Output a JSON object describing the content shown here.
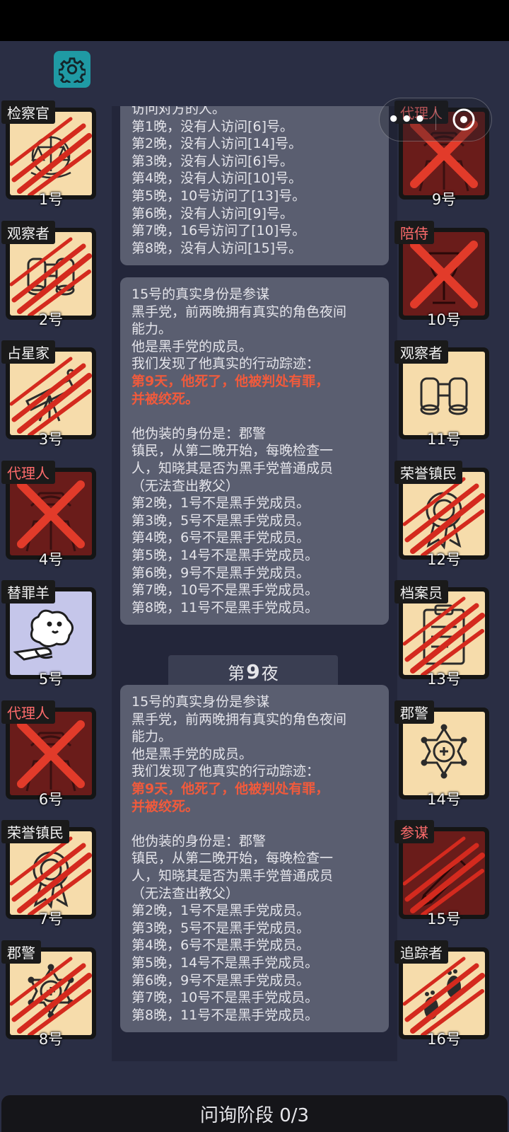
{
  "capsule": {
    "more_icon": "more-dots-icon",
    "close_icon": "target-close-icon"
  },
  "settings_icon": "gear-icon",
  "players_left": [
    {
      "role": "检察官",
      "num": "1号",
      "status": "slashed",
      "art": "scales",
      "role_red": false
    },
    {
      "role": "观察者",
      "num": "2号",
      "status": "slashed",
      "art": "binoculars",
      "role_red": false
    },
    {
      "role": "占星家",
      "num": "3号",
      "status": "slashed",
      "art": "telescope",
      "role_red": false
    },
    {
      "role": "代理人",
      "num": "4号",
      "status": "crossed",
      "art": "agent",
      "role_red": true
    },
    {
      "role": "替罪羊",
      "num": "5号",
      "status": "alive",
      "art": "sheep",
      "role_red": false
    },
    {
      "role": "代理人",
      "num": "6号",
      "status": "crossed",
      "art": "agent",
      "role_red": true
    },
    {
      "role": "荣誉镇民",
      "num": "7号",
      "status": "slashed",
      "art": "medal",
      "role_red": false
    },
    {
      "role": "郡警",
      "num": "8号",
      "status": "slashed",
      "art": "badge",
      "role_red": false
    }
  ],
  "players_right": [
    {
      "role": "代理人",
      "num": "9号",
      "status": "crossed",
      "art": "agent",
      "role_red": true
    },
    {
      "role": "陪侍",
      "num": "10号",
      "status": "crossed",
      "art": "glass",
      "role_red": true
    },
    {
      "role": "观察者",
      "num": "11号",
      "status": "alive",
      "art": "binoculars",
      "role_red": false
    },
    {
      "role": "荣誉镇民",
      "num": "12号",
      "status": "slashed",
      "art": "medal",
      "role_red": false
    },
    {
      "role": "档案员",
      "num": "13号",
      "status": "slashed",
      "art": "clipboard",
      "role_red": false
    },
    {
      "role": "郡警",
      "num": "14号",
      "status": "alive",
      "art": "badge",
      "role_red": false
    },
    {
      "role": "参谋",
      "num": "15号",
      "status": "slashed_dead",
      "art": "pen",
      "role_red": true
    },
    {
      "role": "追踪者",
      "num": "16号",
      "status": "slashed",
      "art": "footprints",
      "role_red": false
    }
  ],
  "messages": {
    "first": [
      "访问对方的人。",
      "第1晚，没有人访问[6]号。",
      "第2晚，没有人访问[14]号。",
      "第3晚，没有人访问[6]号。",
      "第4晚，没有人访问[10]号。",
      "第5晚，10号访问了[13]号。",
      "第6晚，没有人访问[9]号。",
      "第7晚，16号访问了[10]号。",
      "第8晚，没有人访问[15]号。"
    ],
    "second": {
      "identity": [
        "15号的真实身份是参谋",
        "黑手党，前两晚拥有真实的角色夜间",
        "能力。",
        "他是黑手党的成员。",
        "我们发现了他真实的行动踪迹："
      ],
      "death": [
        "第9天，他死了，他被判处有罪，",
        "并被绞死。"
      ],
      "disguise": [
        "他伪装的身份是：郡警",
        "镇民，从第二晚开始，每晚检查一",
        "人，知晓其是否为黑手党普通成员",
        "（无法查出教父）",
        "第2晚，1号不是黑手党成员。",
        "第3晚，5号不是黑手党成员。",
        "第4晚，6号不是黑手党成员。",
        "第5晚，14号不是黑手党成员。",
        "第6晚，9号不是黑手党成员。",
        "第7晚，10号不是黑手党成员。",
        "第8晚，11号不是黑手党成员。"
      ]
    },
    "night_label": {
      "prefix": "第",
      "number": "9",
      "suffix": "夜"
    },
    "third": {
      "identity": [
        "15号的真实身份是参谋",
        "黑手党，前两晚拥有真实的角色夜间",
        "能力。",
        "他是黑手党的成员。",
        "我们发现了他真实的行动踪迹："
      ],
      "death": [
        "第9天，他死了，他被判处有罪，",
        "并被绞死。"
      ],
      "disguise": [
        "他伪装的身份是：郡警",
        "镇民，从第二晚开始，每晚检查一",
        "人，知晓其是否为黑手党普通成员",
        "（无法查出教父）",
        "第2晚，1号不是黑手党成员。",
        "第3晚，5号不是黑手党成员。",
        "第4晚，6号不是黑手党成员。",
        "第5晚，14号不是黑手党成员。",
        "第6晚，9号不是黑手党成员。",
        "第7晚，10号不是黑手党成员。",
        "第8晚，11号不是黑手党成员。"
      ]
    }
  },
  "bottom": {
    "phase_label": "问询阶段 0/3"
  },
  "colors": {
    "background": "#2a2e44",
    "card_alive": "#f6dcab",
    "card_dead": "#6a1c1a",
    "card_sheep": "#c5c6ea",
    "slash_red": "#d42a1e",
    "highlight_text": "#f05a3c",
    "gear_bg": "#1f9aa4"
  }
}
